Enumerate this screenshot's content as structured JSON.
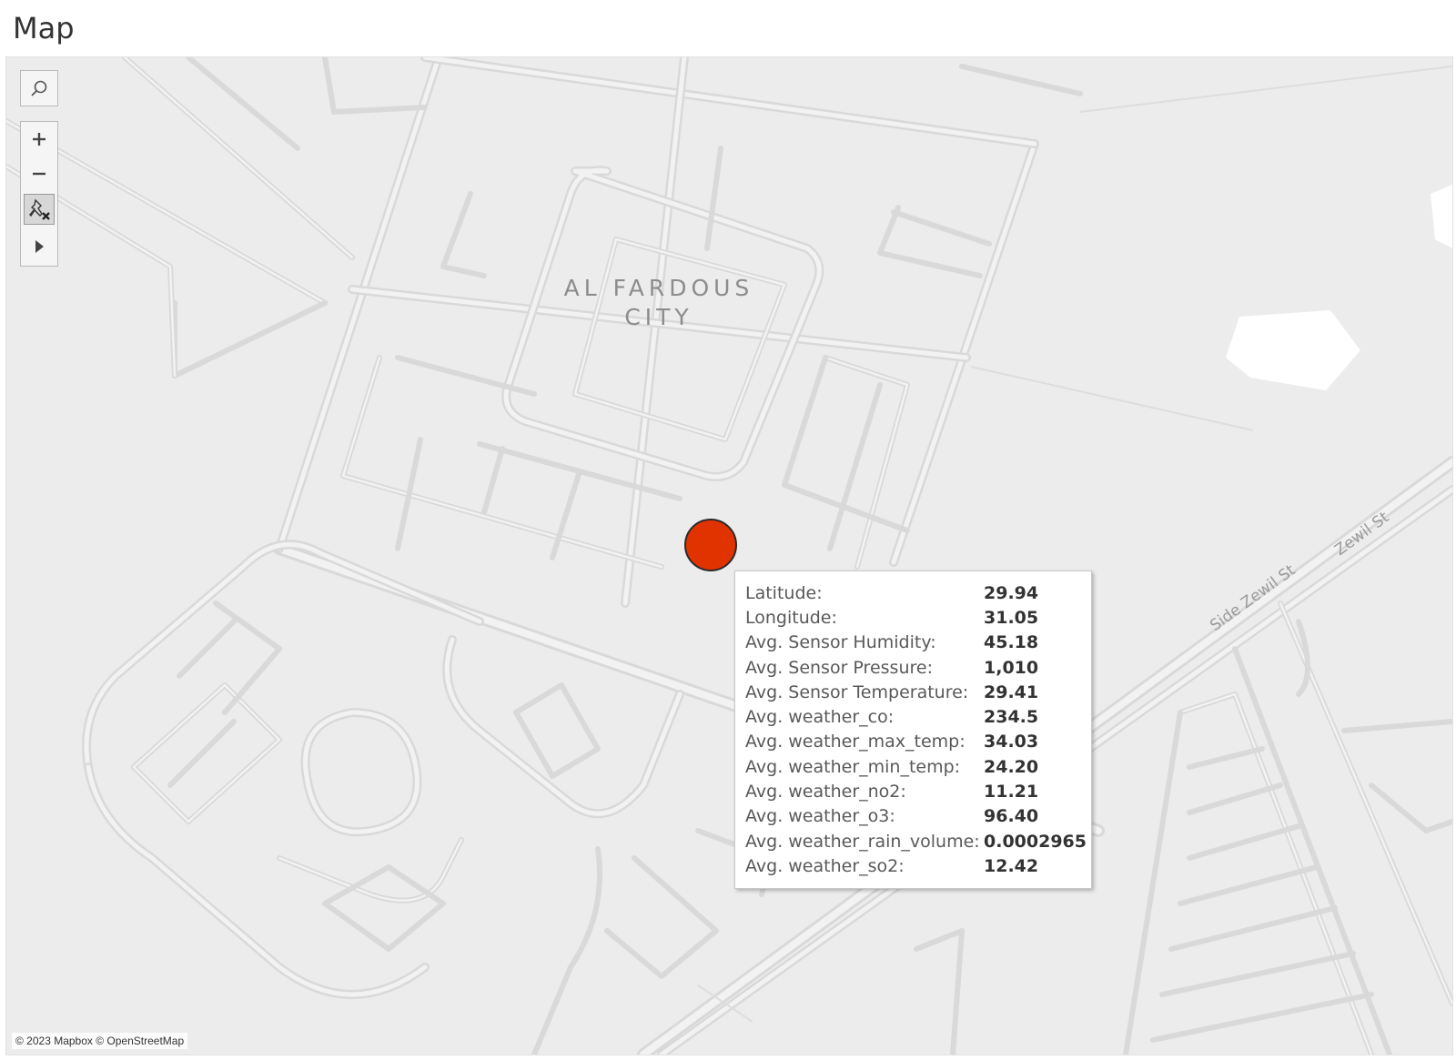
{
  "sheet": {
    "title": "Map"
  },
  "map": {
    "place_label_line1": "AL FARDOUS",
    "place_label_line2": "CITY",
    "street_labels": [
      "Side Zewil St",
      "Zewil St"
    ],
    "attribution": "© 2023 Mapbox © OpenStreetMap",
    "marker_color": "#e13300",
    "background_color": "#ececec"
  },
  "toolbar": {
    "search_icon": "search-icon",
    "zoom_in_icon": "plus-icon",
    "zoom_out_icon": "minus-icon",
    "pin_icon": "unpin-icon",
    "expand_icon": "play-arrow-icon"
  },
  "tooltip": {
    "rows": [
      {
        "label": "Latitude:",
        "value": "29.94"
      },
      {
        "label": "Longitude:",
        "value": "31.05"
      },
      {
        "label": "Avg. Sensor Humidity:",
        "value": "45.18"
      },
      {
        "label": "Avg. Sensor Pressure:",
        "value": "1,010"
      },
      {
        "label": "Avg. Sensor Temperature:",
        "value": "29.41"
      },
      {
        "label": "Avg. weather_co:",
        "value": "234.5"
      },
      {
        "label": "Avg. weather_max_temp:",
        "value": "34.03"
      },
      {
        "label": "Avg. weather_min_temp:",
        "value": "24.20"
      },
      {
        "label": "Avg. weather_no2:",
        "value": "11.21"
      },
      {
        "label": "Avg. weather_o3:",
        "value": "96.40"
      },
      {
        "label": "Avg. weather_rain_volume:",
        "value": "0.0002965"
      },
      {
        "label": "Avg. weather_so2:",
        "value": "12.42"
      }
    ]
  }
}
